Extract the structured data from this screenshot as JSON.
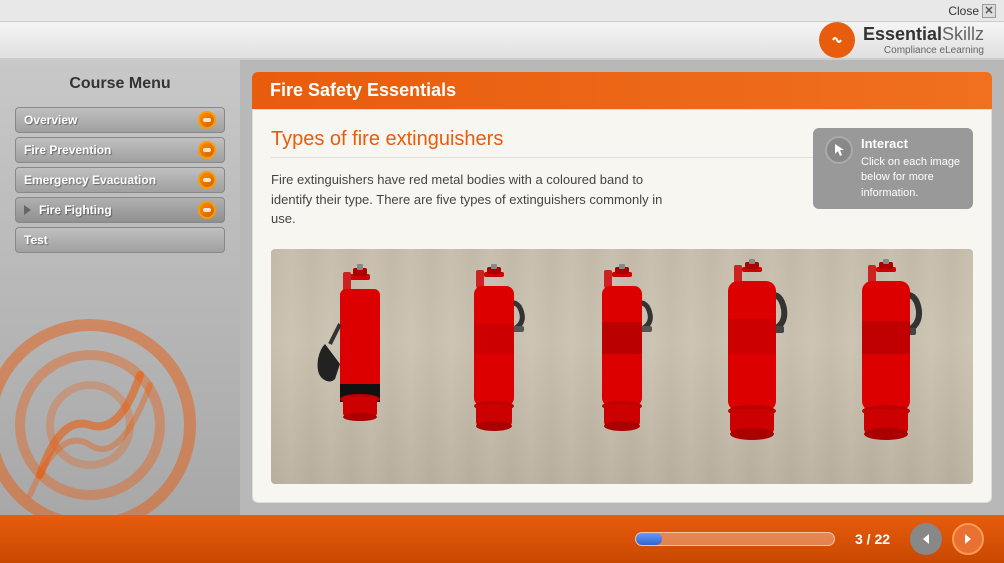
{
  "topbar": {
    "close_label": "Close"
  },
  "header": {
    "logo_alt": "EssentialSkillz",
    "logo_brand": "EssentialSkillz",
    "logo_strong": "Essential",
    "logo_rest": "Skillz",
    "logo_sub": "Compliance eLearning"
  },
  "sidebar": {
    "title": "Course Menu",
    "items": [
      {
        "id": "overview",
        "label": "Overview",
        "has_arrow": false,
        "has_icon": true
      },
      {
        "id": "fire-prevention",
        "label": "Fire Prevention",
        "has_arrow": false,
        "has_icon": true
      },
      {
        "id": "emergency-evacuation",
        "label": "Emergency Evacuation",
        "has_arrow": false,
        "has_icon": true
      },
      {
        "id": "fire-fighting",
        "label": "Fire Fighting",
        "has_arrow": true,
        "has_icon": true
      },
      {
        "id": "test",
        "label": "Test",
        "has_arrow": false,
        "has_icon": false
      }
    ]
  },
  "page": {
    "title": "Fire Safety Essentials",
    "section_title": "Types of fire extinguishers",
    "description": "Fire extinguishers have red metal bodies with a coloured band to identify their type. There are five types of extinguishers commonly in use.",
    "interact_label": "Interact",
    "interact_text": "Click on each image below for more information."
  },
  "navigation": {
    "current_page": 3,
    "total_pages": 22,
    "page_display": "3 / 22",
    "progress_percent": 13
  },
  "extinguishers": [
    {
      "id": "ext1",
      "type": "co2"
    },
    {
      "id": "ext2",
      "type": "water"
    },
    {
      "id": "ext3",
      "type": "powder"
    },
    {
      "id": "ext4",
      "type": "foam"
    },
    {
      "id": "ext5",
      "type": "wet-chemical"
    }
  ]
}
